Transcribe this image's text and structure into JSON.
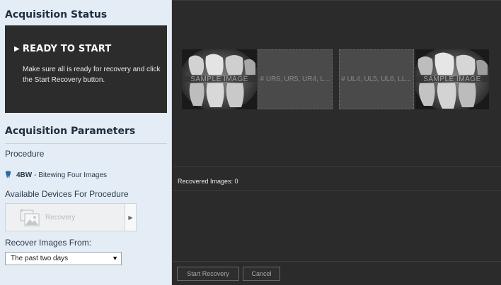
{
  "status": {
    "title": "Acquisition Status",
    "heading_arrow": "▶",
    "heading": "READY TO START",
    "message": "Make sure all is ready for recovery and click the Start Recovery button."
  },
  "params": {
    "title": "Acquisition Parameters",
    "procedure_label": "Procedure",
    "procedure_code": "4BW",
    "procedure_desc": "- Bitewing Four Images",
    "devices_label": "Available Devices For Procedure",
    "device_name": "Recovery",
    "device_arrow": "▶",
    "recover_label": "Recover Images From:",
    "recover_value": "The past two days",
    "dropdown_glyph": "▼"
  },
  "images": {
    "slot1": "SAMPLE IMAGE",
    "slot2": "# UR6, UR5, UR4, L...",
    "slot3": "# UL4, UL5, UL6, LL...",
    "slot4": "SAMPLE IMAGE"
  },
  "recovered": "Recovered Images: 0",
  "buttons": {
    "start": "Start Recovery",
    "cancel": "Cancel"
  },
  "colors": {
    "left_bg": "#e4edf6",
    "status_box": "#2c2c2c",
    "right_bg": "#2b2b2b"
  }
}
